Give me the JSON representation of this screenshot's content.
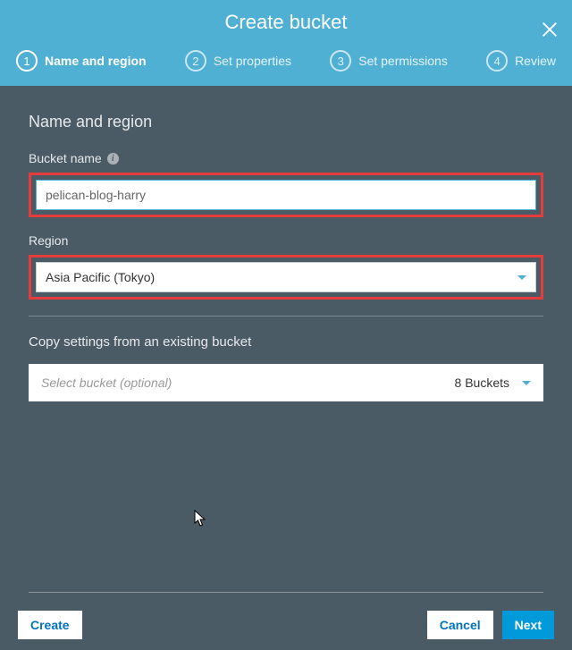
{
  "dialog": {
    "title": "Create bucket"
  },
  "steps": [
    {
      "num": "1",
      "label": "Name and region",
      "active": true
    },
    {
      "num": "2",
      "label": "Set properties",
      "active": false
    },
    {
      "num": "3",
      "label": "Set permissions",
      "active": false
    },
    {
      "num": "4",
      "label": "Review",
      "active": false
    }
  ],
  "form": {
    "section_title": "Name and region",
    "bucket_name_label": "Bucket name",
    "bucket_name_value": "pelican-blog-harry",
    "region_label": "Region",
    "region_value": "Asia Pacific (Tokyo)",
    "copy_label": "Copy settings from an existing bucket",
    "copy_placeholder": "Select bucket (optional)",
    "bucket_count": "8 Buckets"
  },
  "footer": {
    "create": "Create",
    "cancel": "Cancel",
    "next": "Next"
  }
}
